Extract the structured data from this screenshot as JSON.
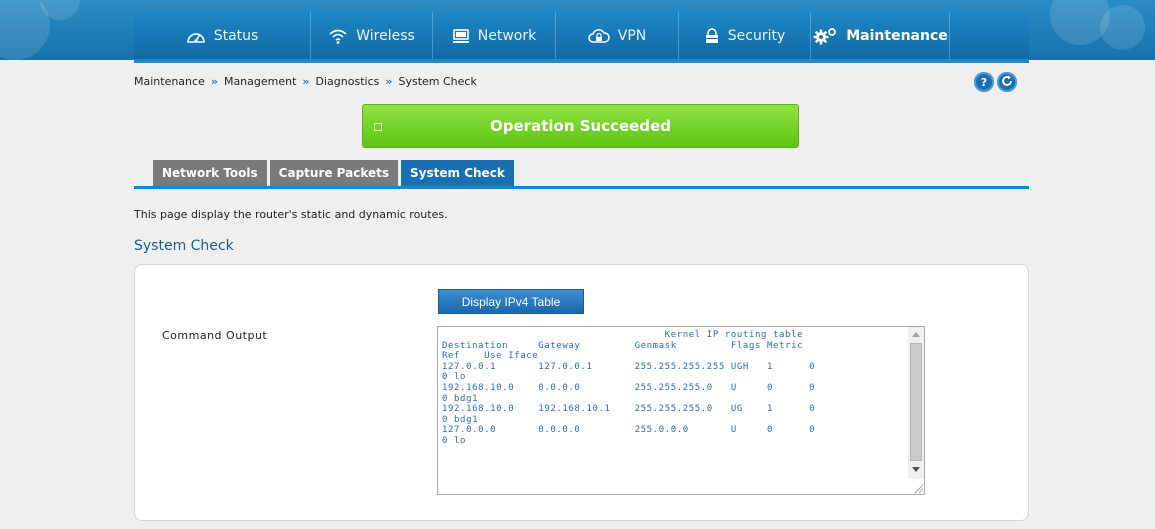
{
  "nav": {
    "items": [
      {
        "label": "Status",
        "icon": "gauge-icon"
      },
      {
        "label": "Wireless",
        "icon": "wifi-icon"
      },
      {
        "label": "Network",
        "icon": "monitor-icon"
      },
      {
        "label": "VPN",
        "icon": "cloud-lock-icon"
      },
      {
        "label": "Security",
        "icon": "lock-icon"
      },
      {
        "label": "Maintenance",
        "icon": "gears-icon"
      }
    ],
    "active": "Maintenance"
  },
  "breadcrumb": {
    "items": [
      "Maintenance",
      "Management",
      "Diagnostics",
      "System Check"
    ],
    "separator": "»"
  },
  "help_button": "?",
  "refresh_icon": "refresh-icon",
  "banner": {
    "message": "Operation Succeeded",
    "color": "#6fd11f"
  },
  "tabs": [
    {
      "label": "Network Tools",
      "active": false
    },
    {
      "label": "Capture Packets",
      "active": false
    },
    {
      "label": "System Check",
      "active": true
    }
  ],
  "description": "This page display the router's static and dynamic routes.",
  "section_title": "System Check",
  "form": {
    "display_button": "Display IPv4 Table",
    "command_output_label": "Command Output",
    "command_output": "                                     Kernel IP routing table\nDestination     Gateway         Genmask         Flags Metric\nRef    Use Iface\n127.0.0.1       127.0.0.1       255.255.255.255 UGH   1      0\n0 lo\n192.168.10.0    0.0.0.0         255.255.255.0   U     0      0\n0 bdg1\n192.168.10.0    192.168.10.1    255.255.255.0   UG    1      0\n0 bdg1\n127.0.0.0       0.0.0.0         255.0.0.0       U     0      0\n0 lo"
  },
  "colors": {
    "accent": "#1a6fb0",
    "nav": "#1f86c3",
    "tab_inactive": "#7a7a7a",
    "success": "#6fd11f"
  }
}
